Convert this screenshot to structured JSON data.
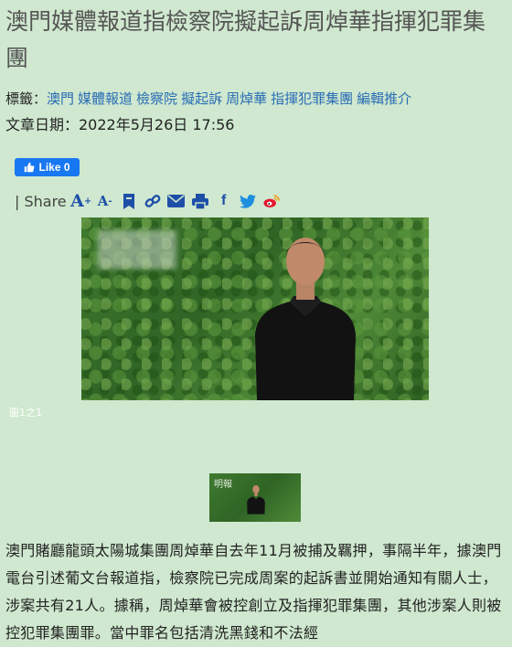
{
  "headline": "澳門媒體報道指檢察院擬起訴周焯華指揮犯罪集團",
  "tags": {
    "label": "標籤：",
    "items": [
      "澳門",
      "媒體報道",
      "檢察院",
      "擬起訴",
      "周焯華",
      "指揮犯罪集團",
      "編輯推介"
    ]
  },
  "date": "文章日期：2022年5月26日 17:56",
  "like_button": {
    "label": "Like 0"
  },
  "share": {
    "label": "| Share"
  },
  "photo": {
    "caption": "圖1之1"
  },
  "thumbnail": {
    "watermark": "明報"
  },
  "article": "澳門賭廳龍頭太陽城集團周焯華自去年11月被捕及羈押，事隔半年，據澳門電台引述葡文台報道指，檢察院已完成周案的起訴書並開始通知有關人士，涉案共有21人。據稱，周焯華會被控創立及指揮犯罪集團，其他涉案人則被控犯罪集團罪。當中罪名包括清洗黑錢和不法經",
  "colors": {
    "background": "#cfe8cf",
    "link": "#2a6db5",
    "like": "#1877f2",
    "icon": "#1e4fa8"
  }
}
